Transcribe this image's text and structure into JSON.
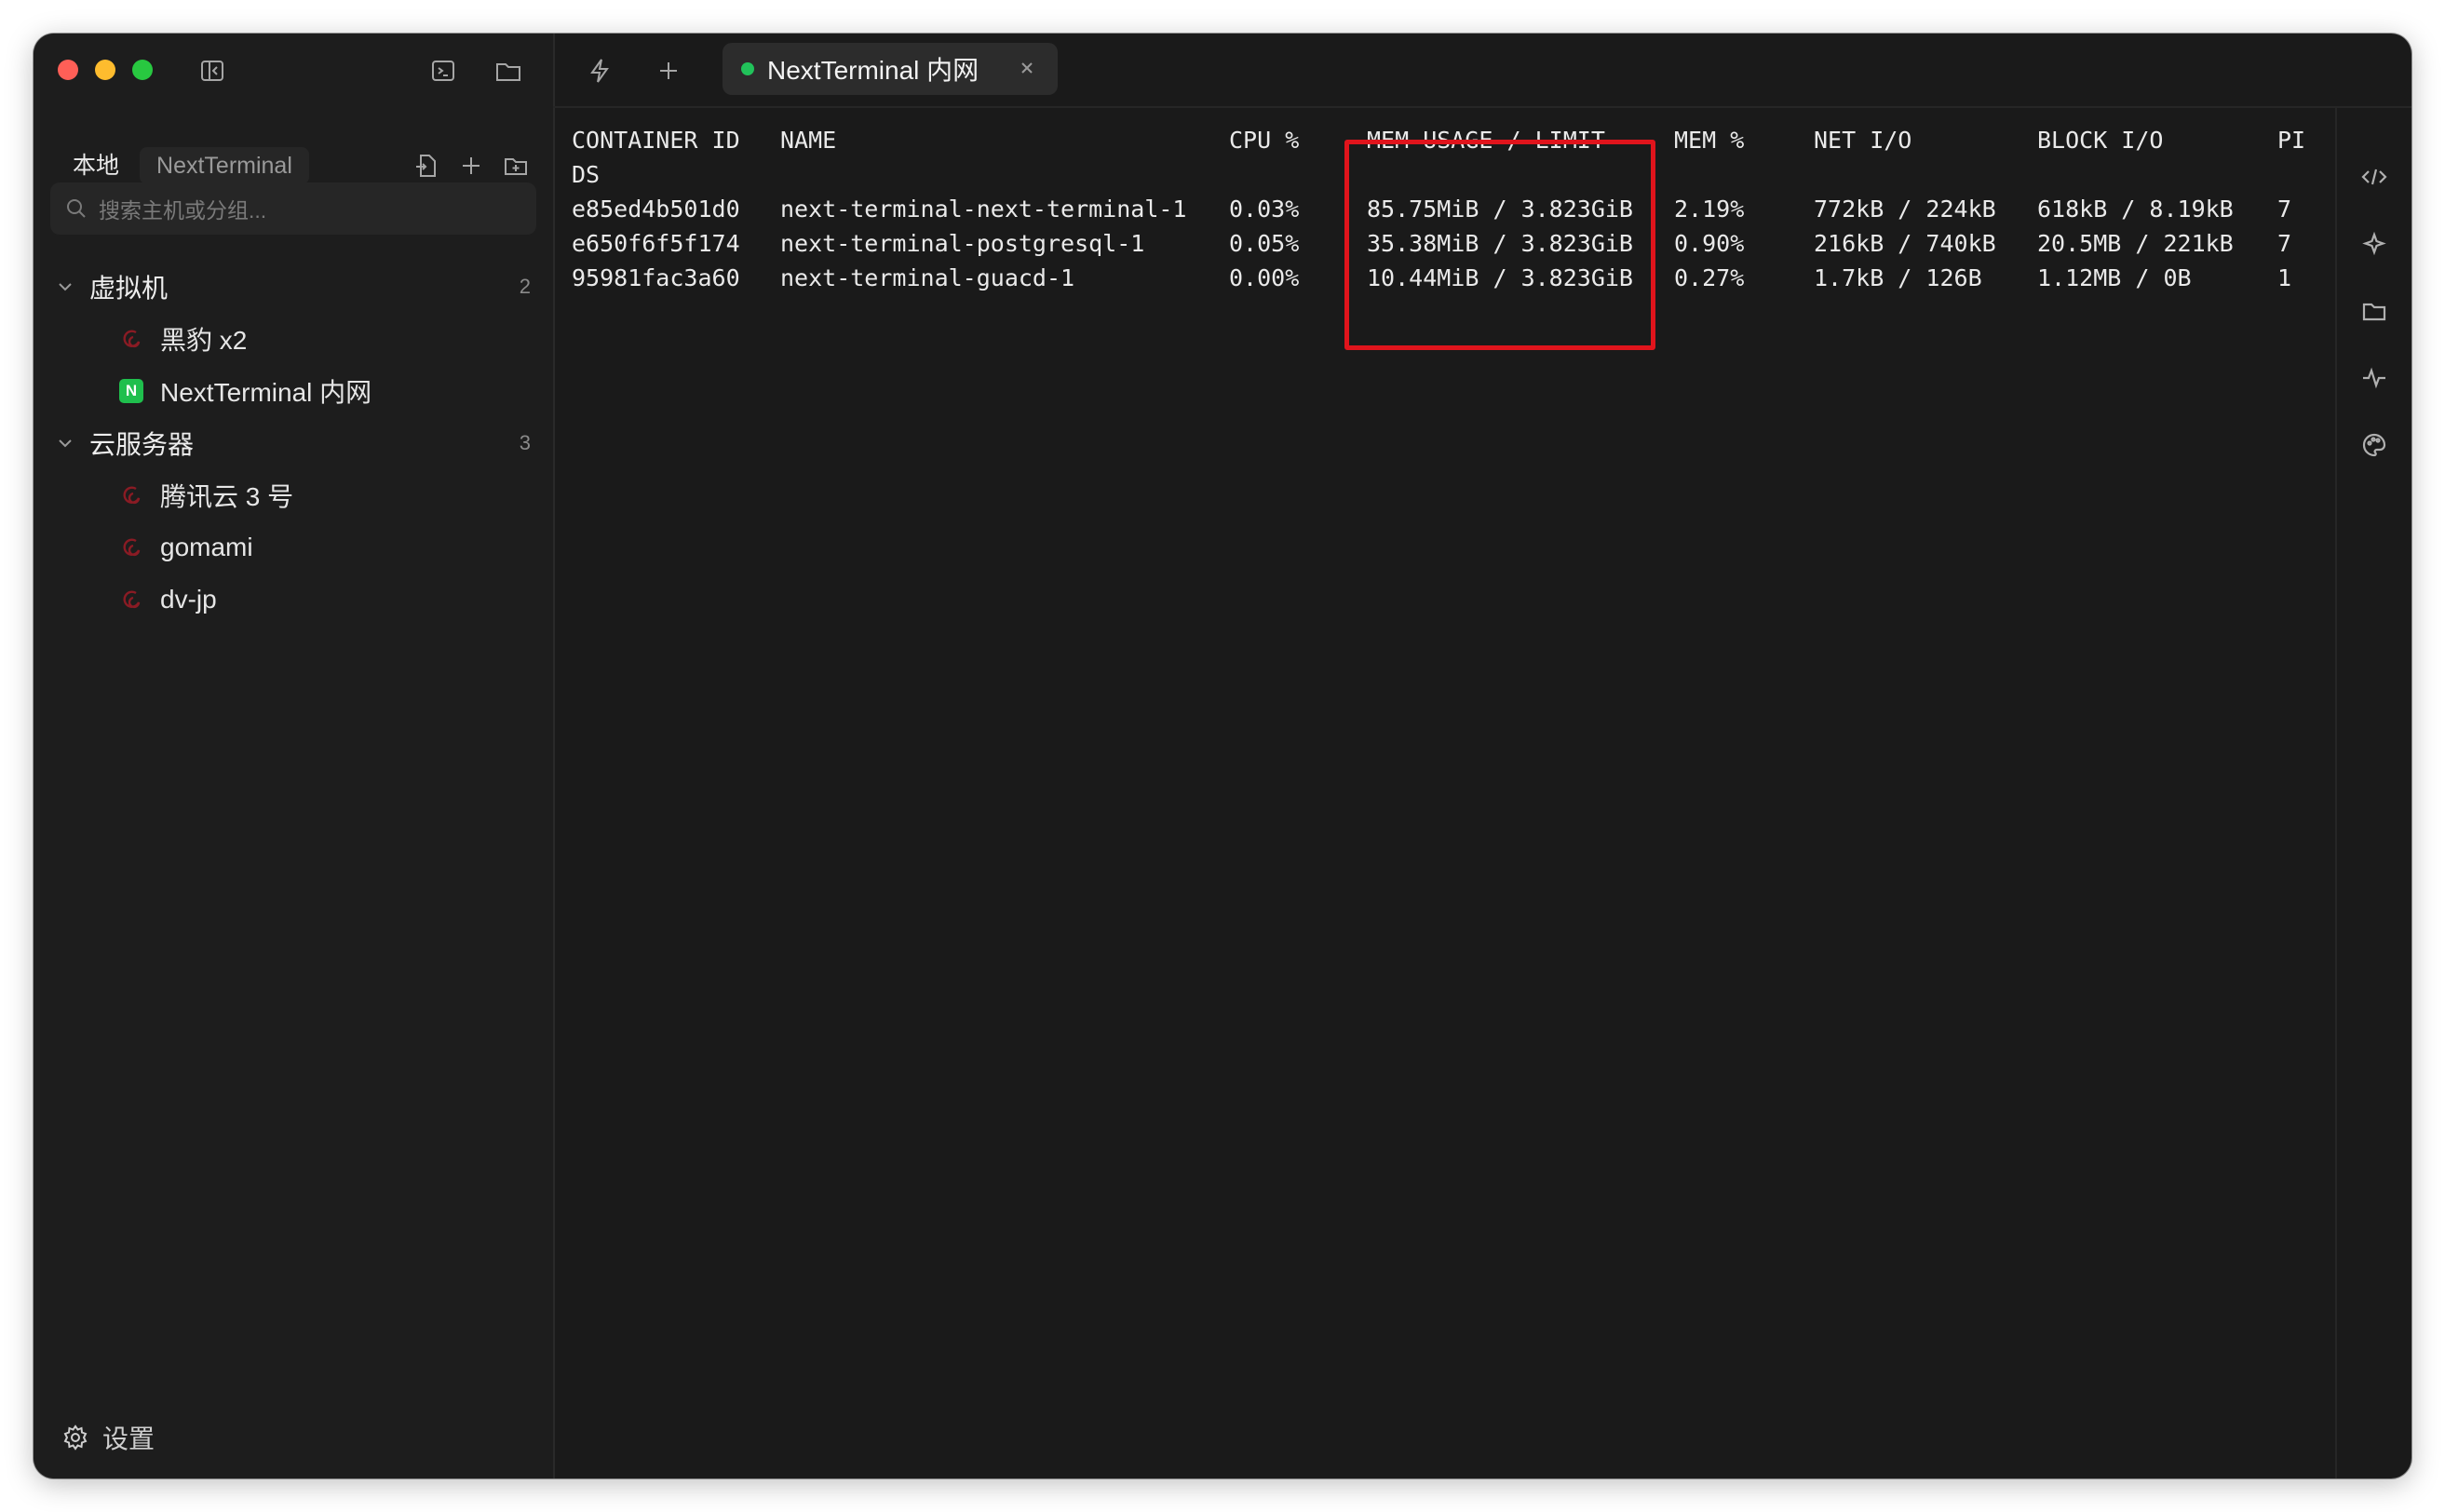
{
  "sidebar": {
    "tabs": [
      "本地",
      "NextTerminal"
    ],
    "search_placeholder": "搜索主机或分组...",
    "groups": [
      {
        "name": "虚拟机",
        "count": "2",
        "hosts": [
          {
            "name": "黑豹 x2",
            "icon": "debian-swirl-icon"
          },
          {
            "name": "NextTerminal 内网",
            "icon": "nextterminal-n-icon",
            "badge": "N"
          }
        ]
      },
      {
        "name": "云服务器",
        "count": "3",
        "hosts": [
          {
            "name": "腾讯云 3 号",
            "icon": "debian-swirl-icon"
          },
          {
            "name": "gomami",
            "icon": "debian-swirl-icon"
          },
          {
            "name": "dv-jp",
            "icon": "debian-swirl-icon"
          }
        ]
      }
    ],
    "settings_label": "设置"
  },
  "tabbar": {
    "active_tab": {
      "label": "NextTerminal 内网",
      "status_color": "#21c25a"
    }
  },
  "terminal": {
    "header": [
      "CONTAINER ID",
      "NAME",
      "CPU %",
      "MEM USAGE / LIMIT",
      "MEM %",
      "NET I/O",
      "BLOCK I/O",
      "PI"
    ],
    "header_wrap": "DS",
    "rows": [
      [
        "e85ed4b501d0",
        "next-terminal-next-terminal-1",
        "0.03%",
        "85.75MiB / 3.823GiB",
        "2.19%",
        "772kB / 224kB",
        "618kB / 8.19kB",
        "7"
      ],
      [
        "e650f6f5f174",
        "next-terminal-postgresql-1",
        "0.05%",
        "35.38MiB / 3.823GiB",
        "0.90%",
        "216kB / 740kB",
        "20.5MB / 221kB",
        "7"
      ],
      [
        "95981fac3a60",
        "next-terminal-guacd-1",
        "0.00%",
        "10.44MiB / 3.823GiB",
        "0.27%",
        "1.7kB / 126B",
        "1.12MB / 0B",
        "1"
      ]
    ],
    "highlight_color": "#e0141c"
  },
  "colors": {
    "window_bg": "#1a1a1a",
    "sidebar_bg": "#1d1d1d",
    "accent_green": "#21c25a",
    "highlight_red": "#e0141c"
  }
}
